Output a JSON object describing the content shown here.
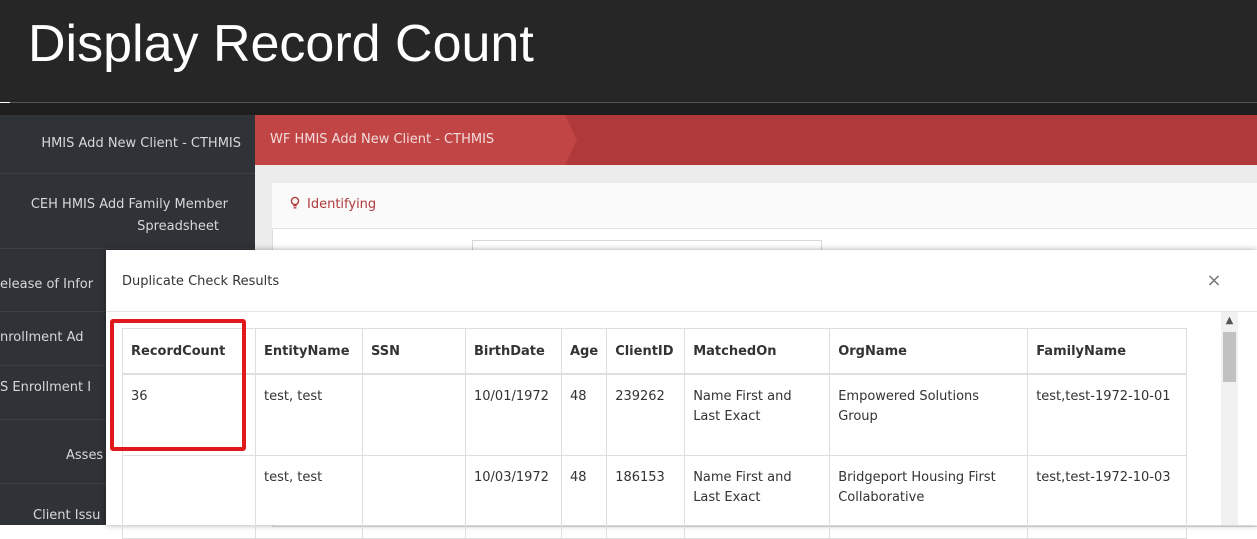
{
  "banner": {
    "title": "Display Record Count"
  },
  "sidebar": {
    "items": [
      {
        "label": "HMIS Add New Client - CTHMIS"
      },
      {
        "label_line1": "CEH HMIS Add Family Member",
        "label_line2": "Spreadsheet"
      },
      {
        "label": "elease of Infor"
      },
      {
        "label": "nrollment Ad"
      },
      {
        "label": "S Enrollment I"
      },
      {
        "label": "Asses"
      },
      {
        "label": "Client Issu"
      }
    ]
  },
  "breadcrumb": {
    "label": "WF HMIS Add New Client - CTHMIS"
  },
  "panel": {
    "title": "Identifying"
  },
  "modal": {
    "title": "Duplicate Check Results",
    "close_label": "×",
    "table": {
      "columns": [
        "RecordCount",
        "EntityName",
        "SSN",
        "BirthDate",
        "Age",
        "ClientID",
        "MatchedOn",
        "OrgName",
        "FamilyName"
      ],
      "rows": [
        [
          "36",
          "test, test",
          "",
          "10/01/1972",
          "48",
          "239262",
          "Name First and Last Exact",
          "Empowered Solutions Group",
          "test,test-1972-10-01"
        ],
        [
          "",
          "test, test",
          "",
          "10/03/1972",
          "48",
          "186153",
          "Name First and Last Exact",
          "Bridgeport Housing First Collaborative",
          "test,test-1972-10-03"
        ]
      ]
    }
  },
  "scrollbar": {
    "up_icon": "▲"
  },
  "colors": {
    "accent": "#b03a3a",
    "highlight": "#e0191c",
    "banner_bg": "#262626",
    "sidebar_bg": "#2f3237"
  }
}
